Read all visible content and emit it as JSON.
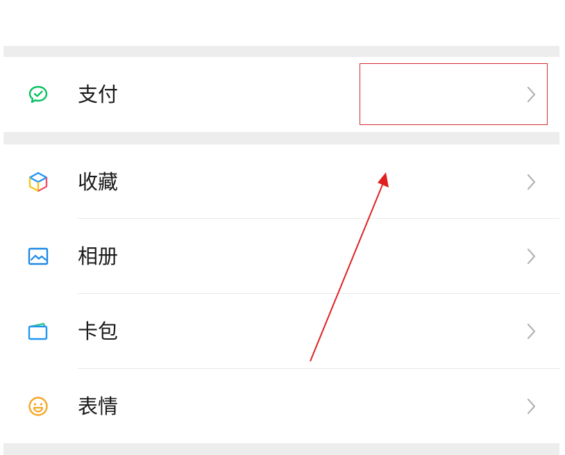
{
  "menu": {
    "items": [
      {
        "key": "pay",
        "label": "支付",
        "icon": "wechat-pay-icon"
      },
      {
        "key": "favorites",
        "label": "收藏",
        "icon": "favorites-cube-icon"
      },
      {
        "key": "album",
        "label": "相册",
        "icon": "photo-album-icon"
      },
      {
        "key": "cards",
        "label": "卡包",
        "icon": "card-wallet-icon"
      },
      {
        "key": "stickers",
        "label": "表情",
        "icon": "smiley-sticker-icon"
      }
    ]
  },
  "colors": {
    "section_gap": "#ededed",
    "pay_green": "#07c160",
    "album_blue": "#1e88e5",
    "card_blue": "#2196f3",
    "sticker_orange": "#f5a623",
    "annotation_red": "#d42a2a",
    "chevron_gray": "#b2b2b2"
  }
}
